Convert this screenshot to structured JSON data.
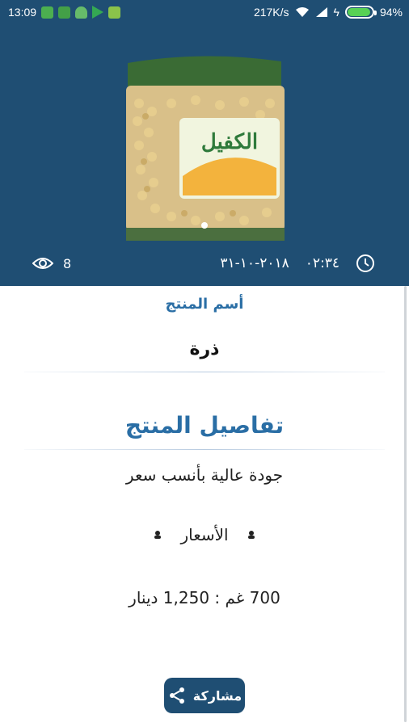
{
  "status_bar": {
    "time": "13:09",
    "network_speed": "217K/s",
    "battery_percent": "94%",
    "battery_level": 0.94,
    "icons": [
      "app-notification-icon",
      "app-notification-icon",
      "app-notification-icon",
      "play-store-icon",
      "app-notification-icon",
      "wifi-icon",
      "signal-icon",
      "charging-icon",
      "battery-icon"
    ]
  },
  "hero": {
    "brand_text": "الكفيل",
    "views_count": "8",
    "date": "٢٠١٨-١٠-٣١",
    "time": "٠٢:٣٤",
    "icons": [
      "eye-icon",
      "clock-icon"
    ]
  },
  "content": {
    "name_label": "أسم المنتج",
    "product_name": "ذرة",
    "details_title": "تفاصيل المنتج",
    "details_text": "جودة عالية بأنسب سعر",
    "prices_label": "الأسعار",
    "price_line": "700 غم :  1,250 دينار",
    "share_label": "مشاركة"
  },
  "colors": {
    "header_bg": "#1f4e73",
    "accent": "#2a6ea5"
  }
}
